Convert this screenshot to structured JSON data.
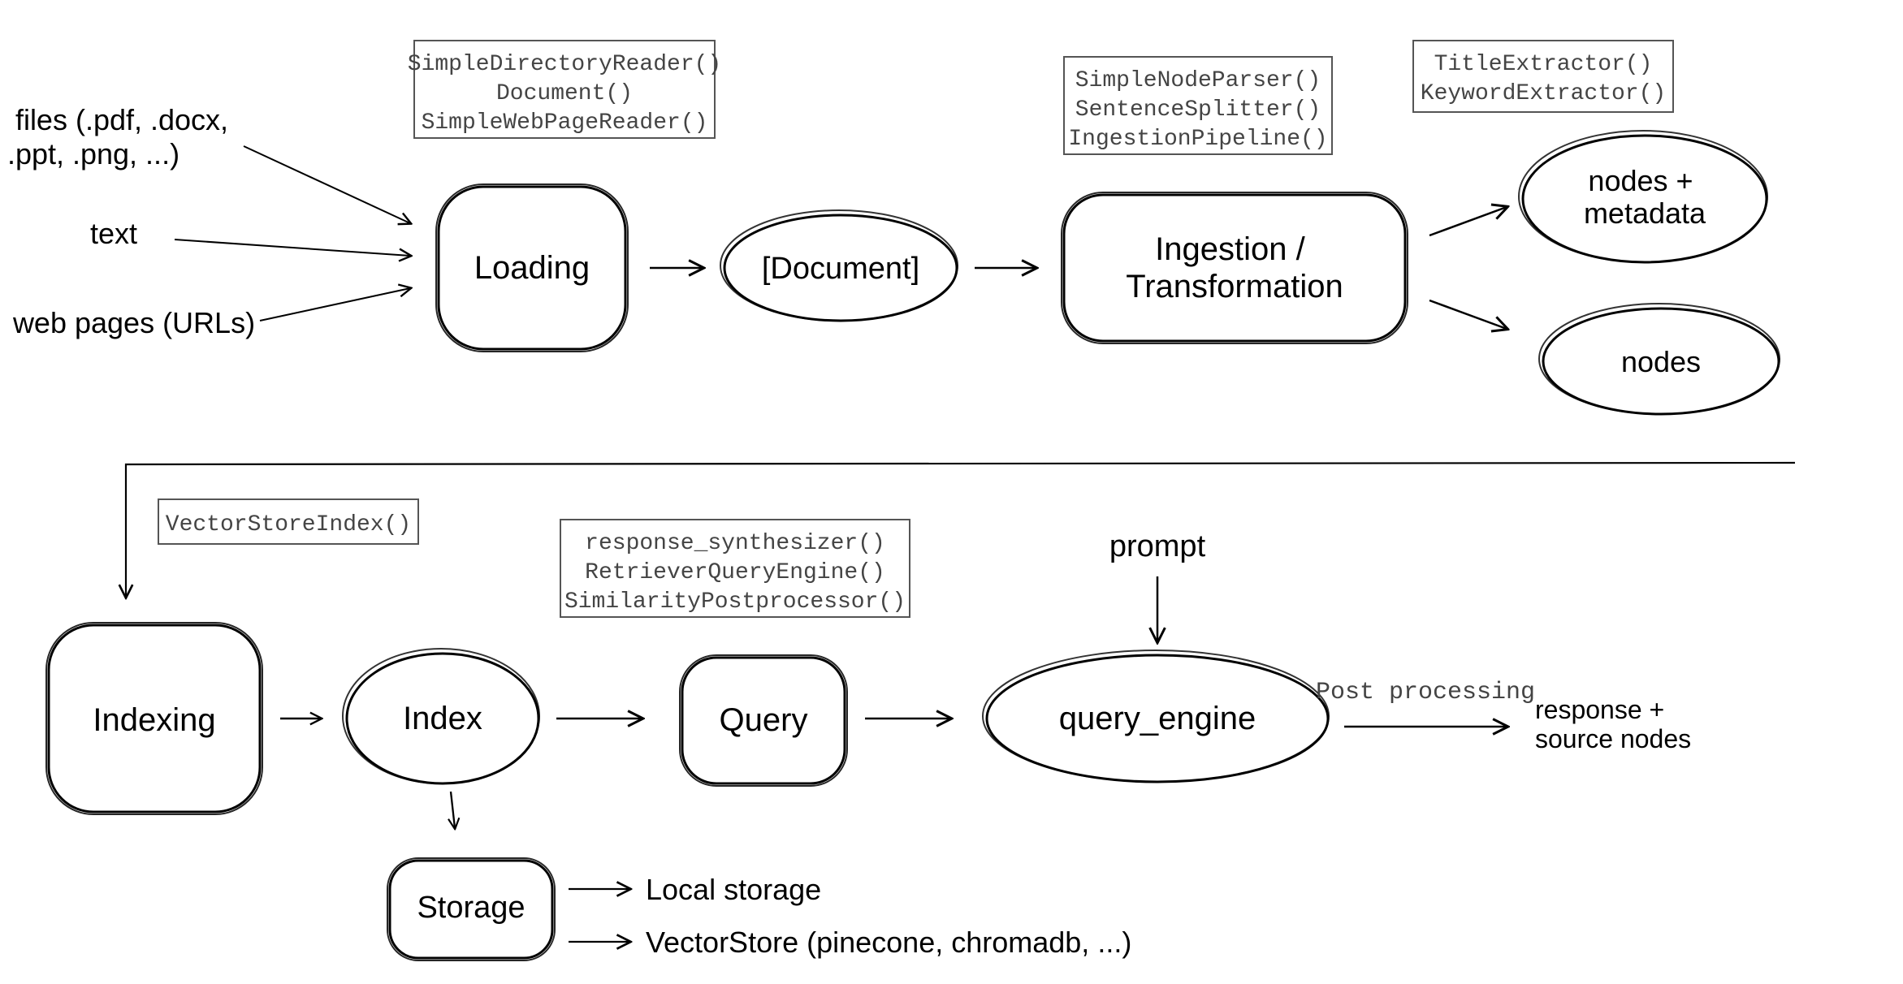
{
  "inputs": {
    "files": {
      "line1": "files (.pdf, .docx,",
      "line2": ".ppt, .png, ...)"
    },
    "text": "text",
    "web": "web pages (URLs)"
  },
  "loading": {
    "label": "Loading",
    "api": [
      "SimpleDirectoryReader()",
      "Document()",
      "SimpleWebPageReader()"
    ]
  },
  "document": {
    "label": "[Document]"
  },
  "ingestion": {
    "line1": "Ingestion /",
    "line2": "Transformation",
    "api": [
      "SimpleNodeParser()",
      "SentenceSplitter()",
      "IngestionPipeline()"
    ],
    "extractors": [
      "TitleExtractor()",
      "KeywordExtractor()"
    ]
  },
  "nodes_meta": {
    "line1": "nodes +",
    "line2": "metadata"
  },
  "nodes": {
    "label": "nodes"
  },
  "indexing": {
    "label": "Indexing",
    "api": [
      "VectorStoreIndex()"
    ]
  },
  "index": {
    "label": "Index"
  },
  "storage": {
    "label": "Storage",
    "local": "Local storage",
    "vector": "VectorStore (pinecone, chromadb, ...)"
  },
  "query": {
    "label": "Query",
    "api": [
      "response_synthesizer()",
      "RetrieverQueryEngine()",
      "SimilarityPostprocessor()"
    ]
  },
  "prompt": {
    "label": "prompt"
  },
  "query_engine": {
    "label": "query_engine"
  },
  "post_processing": {
    "label": "Post processing"
  },
  "response": {
    "line1": "response +",
    "line2": "source nodes"
  }
}
